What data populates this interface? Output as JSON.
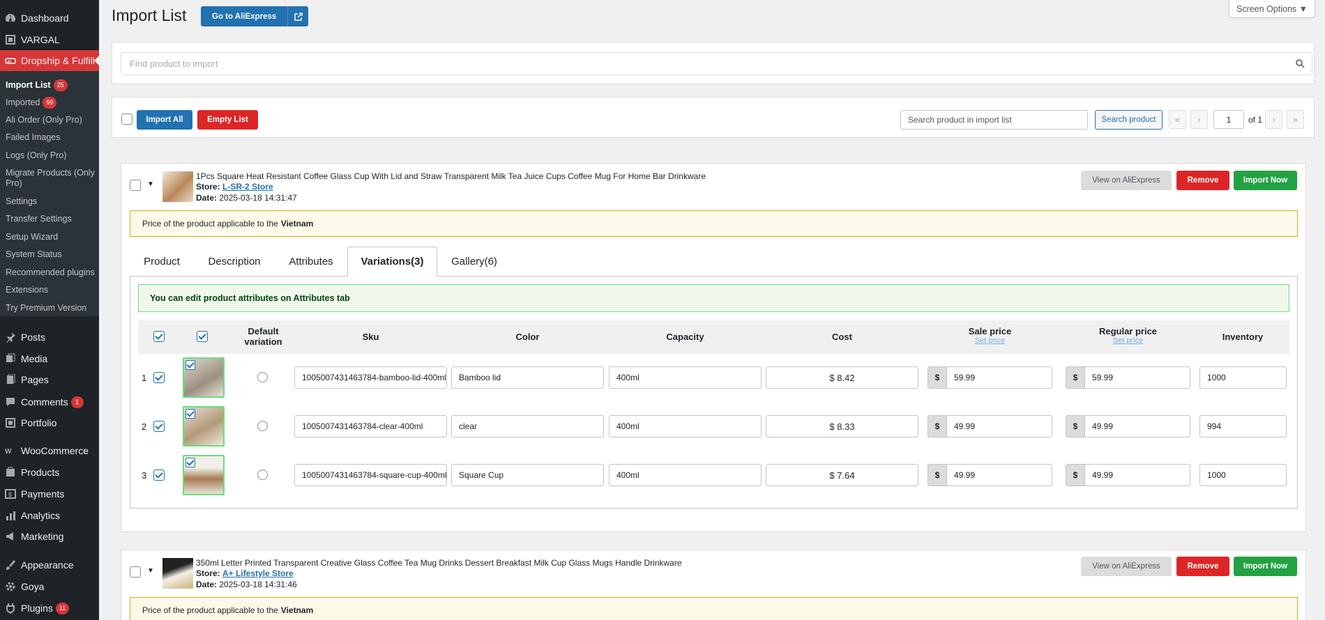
{
  "sidebar": {
    "items": [
      {
        "label": "Dashboard",
        "icon": "dashboard-icon"
      },
      {
        "label": "VARGAL",
        "icon": "vargal-icon"
      },
      {
        "label": "Dropship & Fulfill",
        "icon": "ali-icon"
      },
      {
        "label": "Posts",
        "icon": "pin-icon"
      },
      {
        "label": "Media",
        "icon": "media-icon"
      },
      {
        "label": "Pages",
        "icon": "pages-icon"
      },
      {
        "label": "Comments",
        "icon": "comments-icon",
        "badge": "1"
      },
      {
        "label": "Portfolio",
        "icon": "portfolio-icon"
      },
      {
        "label": "WooCommerce",
        "icon": "woo-icon"
      },
      {
        "label": "Products",
        "icon": "products-icon"
      },
      {
        "label": "Payments",
        "icon": "payments-icon"
      },
      {
        "label": "Analytics",
        "icon": "analytics-icon"
      },
      {
        "label": "Marketing",
        "icon": "marketing-icon"
      },
      {
        "label": "Appearance",
        "icon": "appearance-icon"
      },
      {
        "label": "Goya",
        "icon": "gear-icon"
      },
      {
        "label": "Plugins",
        "icon": "plugins-icon",
        "badge": "11"
      }
    ],
    "submenu": [
      {
        "label": "Import List",
        "badge": "25"
      },
      {
        "label": "Imported",
        "badge": "99"
      },
      {
        "label": "Ali Order (Only Pro)"
      },
      {
        "label": "Failed Images"
      },
      {
        "label": "Logs (Only Pro)"
      },
      {
        "label": "Migrate Products (Only Pro)"
      },
      {
        "label": "Settings"
      },
      {
        "label": "Transfer Settings"
      },
      {
        "label": "Setup Wizard"
      },
      {
        "label": "System Status"
      },
      {
        "label": "Recommended plugins"
      },
      {
        "label": "Extensions"
      },
      {
        "label": "Try Premium Version"
      }
    ]
  },
  "header": {
    "title": "Import List",
    "go_button": "Go to AliExpress",
    "screen_options": "Screen Options ▼"
  },
  "search": {
    "placeholder": "Find product to import"
  },
  "toolbar": {
    "import_all": "Import All",
    "empty_list": "Empty List",
    "search_placeholder": "Search product in import list",
    "search_button": "Search product",
    "page": "1",
    "of_label": "of 1"
  },
  "actions": {
    "view": "View on AliExpress",
    "remove": "Remove",
    "import": "Import Now"
  },
  "products": [
    {
      "title": "1Pcs Square Heat Resistant Coffee Glass Cup With Lid and Straw Transparent Milk Tea Juice Cups Coffee Mug For Home Bar Drinkware",
      "store_label": "Store:",
      "store": "L-SR-2 Store",
      "date_label": "Date:",
      "date": "2025-03-18 14:31:47",
      "notice": "Price of the product applicable to the",
      "country": "Vietnam"
    },
    {
      "title": "350ml Letter Printed Transparent Creative Glass Coffee Tea Mug Drinks Dessert Breakfast Milk Cup Glass Mugs Handle Drinkware",
      "store_label": "Store:",
      "store": "A+ Lifestyle Store",
      "date_label": "Date:",
      "date": "2025-03-18 14:31:46",
      "notice": "Price of the product applicable to the",
      "country": "Vietnam"
    }
  ],
  "tabs": [
    "Product",
    "Description",
    "Attributes",
    "Variations(3)",
    "Gallery(6)"
  ],
  "info_message": "You can edit product attributes on Attributes tab",
  "table": {
    "headers": {
      "default": "Default variation",
      "sku": "Sku",
      "color": "Color",
      "capacity": "Capacity",
      "cost": "Cost",
      "sale": "Sale price",
      "regular": "Regular price",
      "inventory": "Inventory",
      "set_price": "Set price"
    },
    "currency": "$",
    "rows": [
      {
        "n": "1",
        "sku": "1005007431463784-bamboo-lid-400ml",
        "color": "Bamboo lid",
        "capacity": "400ml",
        "cost": "$ 8.42",
        "sale": "59.99",
        "regular": "59.99",
        "inventory": "1000"
      },
      {
        "n": "2",
        "sku": "1005007431463784-clear-400ml",
        "color": "clear",
        "capacity": "400ml",
        "cost": "$ 8.33",
        "sale": "49.99",
        "regular": "49.99",
        "inventory": "994"
      },
      {
        "n": "3",
        "sku": "1005007431463784-square-cup-400ml",
        "color": "Square Cup",
        "capacity": "400ml",
        "cost": "$ 7.64",
        "sale": "49.99",
        "regular": "49.99",
        "inventory": "1000"
      }
    ]
  }
}
